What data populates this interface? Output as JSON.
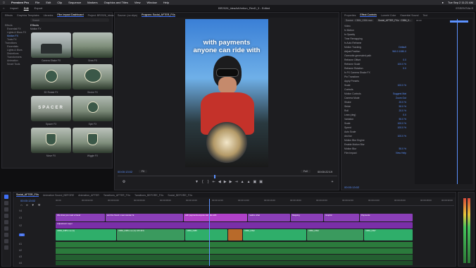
{
  "menubar": {
    "app": "Premiere Pro",
    "items": [
      "File",
      "Edit",
      "Clip",
      "Sequence",
      "Markers",
      "Graphics and Titles",
      "View",
      "Window",
      "Help"
    ],
    "clock": "Tue Sep 2  11:21 AM"
  },
  "workspace": {
    "items": [
      "Import",
      "Edit",
      "Export"
    ],
    "active": "Edit",
    "title": "BR2026_ldeaAdVertion_RevD_3 - Edited",
    "right_label": "ESSENTIALS"
  },
  "left_panel": {
    "tabs": [
      "Effects",
      "Graphics Templates",
      "Libraries",
      "Film Impact Dashboard",
      "Project: BR2026_Ideas"
    ],
    "active_tab": "Film Impact Dashboard",
    "search_placeholder": "Search",
    "tree": [
      "Effects",
      "Essential FX",
      "Lights & Blurs FX",
      "Motion FX",
      "Tools FX",
      "Transitions",
      "Essentials",
      "Lights & Blurs",
      "Distortions",
      "Transformers",
      "Animation",
      "Smart Tools"
    ],
    "selected": "Motion FX",
    "section_title": "Effects",
    "section_sub": "Motion FX",
    "thumbs": [
      {
        "label": "Camera Shake FX"
      },
      {
        "label": "Grow FX"
      },
      {
        "label": "3D Rotate FX"
      },
      {
        "label": "Stroke FX"
      },
      {
        "label": "Spacer FX"
      },
      {
        "label": "Spin FX"
      },
      {
        "label": "Move FX"
      },
      {
        "label": "Wiggle FX"
      }
    ],
    "thumb_texts": {
      "t5": "SPACER"
    }
  },
  "program": {
    "tabs": [
      "Source: (no clips)",
      "Program: Social_AFTER_FXs"
    ],
    "active_tab": "Program: Social_AFTER_FXs",
    "caption_line1": "with payments",
    "caption_line2": "anyone can ride with",
    "timecode_in": "00:00:13:02",
    "fit": "Fit",
    "quality": "Full",
    "timecode_out": "00:00:22:19"
  },
  "effect_controls": {
    "tabs": [
      "Properties",
      "Effect Controls",
      "Lumetri Color",
      "Essential Sound",
      "Text"
    ],
    "active_tab": "Effect Controls",
    "source": "Source · CB84_0386.mov",
    "clip": "Social_AFTER_FXs · CB84_0...",
    "timeline_time": "00:00",
    "rows": [
      {
        "label": "Video",
        "value": ""
      },
      {
        "label": "fx  Motion",
        "value": ""
      },
      {
        "label": "fx  Opacity",
        "value": ""
      },
      {
        "label": "   Time Remapping",
        "value": ""
      },
      {
        "label": "fx  Auto Reframe",
        "value": ""
      },
      {
        "label": "      Motion Tracking",
        "value": "Default"
      },
      {
        "label": "      Adjust Position",
        "value": "960.0   1080.0"
      },
      {
        "label": "      Overwrite generated path",
        "value": ""
      },
      {
        "label": "      Reframe Offset",
        "value": "0.0"
      },
      {
        "label": "      Reframe Scale",
        "value": "100.0 %"
      },
      {
        "label": "      Reframe Rotation",
        "value": "0.0"
      },
      {
        "label": "fx  FX Camera Shake FX",
        "value": ""
      },
      {
        "label": "   Pin Transform",
        "value": ""
      },
      {
        "label": "      Apply Presets",
        "value": ""
      },
      {
        "label": "      Scale",
        "value": "100.0 %"
      },
      {
        "label": "   Controls",
        "value": ""
      },
      {
        "label": "      Motion Controls",
        "value": "Suggest Mat"
      },
      {
        "label": "      Camera Mode",
        "value": "Zoom Out"
      },
      {
        "label": "      Shake",
        "value": "20.0 %"
      },
      {
        "label": "      Stride",
        "value": "50.0 %"
      },
      {
        "label": "      Roll",
        "value": "20.0 %"
      },
      {
        "label": "      Lean (deg)",
        "value": "0.0"
      },
      {
        "label": "      Variation",
        "value": "50.0 %"
      },
      {
        "label": "      Scale",
        "value": "100.0 %"
      },
      {
        "label": "      Speed",
        "value": "100.0 %"
      },
      {
        "label": "      Auto Scale",
        "value": ""
      },
      {
        "label": "      Anchor",
        "value": "100.0 %"
      },
      {
        "label": "   Motion Blur Engine",
        "value": ""
      },
      {
        "label": "      Enable Motion Blur",
        "value": ""
      },
      {
        "label": "      Motion Blur",
        "value": "50.0 %"
      },
      {
        "label": "      Film Impact",
        "value": "View Help"
      }
    ],
    "footer_time": "00:00:13:02"
  },
  "timeline": {
    "tabs": [
      "Social_AFTER_FXs",
      "Animation Sound_BEFORE",
      "Animation_AFTER",
      "Tansitions_AFTER_FXs",
      "Tansitions_BEFORE_FXs",
      "Social_BEFORE_FXs"
    ],
    "active_tab": "Social_AFTER_FXs",
    "timecode": "00:00:13:02",
    "ruler": [
      "00:00",
      "00:00:02:00",
      "00:00:04:00",
      "00:00:06:00",
      "00:00:08:00",
      "00:00:10:00",
      "00:00:12:00",
      "00:00:14:00",
      "00:00:16:00",
      "00:00:18:00",
      "00:00:20:00",
      "00:00:22:00",
      "00:00:24:00",
      "00:00:26:00",
      "00:00:28:00",
      "00:00:30:00"
    ],
    "tracks": [
      "V4",
      "V3",
      "V2",
      "V1",
      "A1",
      "A2",
      "A3",
      "A4"
    ],
    "v3_clips": [
      "We show you read a friend",
      "and the friend s new wonder fa",
      "with payments anyone can ride with",
      "realize what",
      "Mapping",
      "Graphic",
      "Payments"
    ],
    "v2_clips": [
      "Adjustment Layer"
    ],
    "v1_clips": [
      "CB84_0385.mov [V]",
      "CB84_0386.mov [V] 105.34%",
      "CB84_0385",
      "CB84_0392",
      "CB84_0394",
      "CB84_0397"
    ]
  },
  "colors": {
    "accent": "#3f6ff5",
    "clip_purple": "#8b3fb8",
    "clip_magenta": "#b041c8",
    "clip_green": "#2fae6a",
    "audio_green": "#2b7a3c",
    "timecode_blue": "#5c92ff"
  }
}
